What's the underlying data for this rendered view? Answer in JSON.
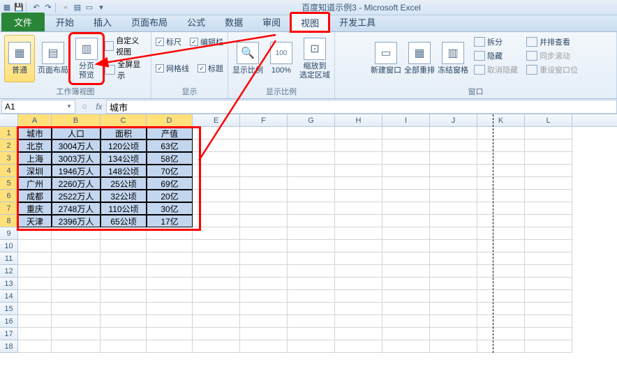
{
  "app": {
    "title": "百度知道示例3 - Microsoft Excel"
  },
  "qat": {
    "icons": [
      "excel-icon",
      "save-icon",
      "undo-icon",
      "redo-icon",
      "new-icon",
      "open-icon",
      "print-preview-icon",
      "quick-print-icon",
      "dropdown-icon"
    ]
  },
  "tabs": {
    "file": "文件",
    "items": [
      "开始",
      "插入",
      "页面布局",
      "公式",
      "数据",
      "审阅",
      "视图",
      "开发工具"
    ],
    "active_index": 6
  },
  "ribbon": {
    "group_workbook_views": {
      "label": "工作簿视图",
      "normal": "普通",
      "page_layout": "页面布局",
      "page_break": "分页\n预览",
      "custom_views": "自定义视图",
      "full_screen": "全屏显示"
    },
    "group_show": {
      "label": "显示",
      "ruler": "标尺",
      "gridlines": "网格线",
      "formula_bar": "编辑栏",
      "headings": "标题"
    },
    "group_zoom": {
      "label": "显示比例",
      "zoom": "显示比例",
      "hundred": "100%",
      "zoom_selection": "缩放到\n选定区域"
    },
    "group_window": {
      "label": "窗口",
      "new_window": "新建窗口",
      "arrange_all": "全部重排",
      "freeze": "冻结窗格",
      "split": "拆分",
      "hide": "隐藏",
      "unhide": "取消隐藏",
      "side_by_side": "并排查看",
      "sync_scroll": "同步滚动",
      "reset_pos": "重设窗口位"
    }
  },
  "namebox": {
    "value": "A1"
  },
  "formula": {
    "value": "城市"
  },
  "columns": [
    "A",
    "B",
    "C",
    "D",
    "E",
    "F",
    "G",
    "H",
    "I",
    "J",
    "K",
    "L"
  ],
  "selected_cols": [
    "A",
    "B",
    "C",
    "D"
  ],
  "selected_rows": [
    1,
    2,
    3,
    4,
    5,
    6,
    7,
    8
  ],
  "row_count": 18,
  "table": {
    "headers": [
      "城市",
      "人口",
      "面积",
      "产值"
    ],
    "rows": [
      [
        "北京",
        "3004万人",
        "120公顷",
        "63亿"
      ],
      [
        "上海",
        "3003万人",
        "134公顷",
        "58亿"
      ],
      [
        "深圳",
        "1946万人",
        "148公顷",
        "70亿"
      ],
      [
        "广州",
        "2260万人",
        "25公顷",
        "69亿"
      ],
      [
        "成都",
        "2522万人",
        "32公顷",
        "20亿"
      ],
      [
        "重庆",
        "2748万人",
        "110公顷",
        "30亿"
      ],
      [
        "天津",
        "2396万人",
        "65公顷",
        "17亿"
      ]
    ]
  }
}
